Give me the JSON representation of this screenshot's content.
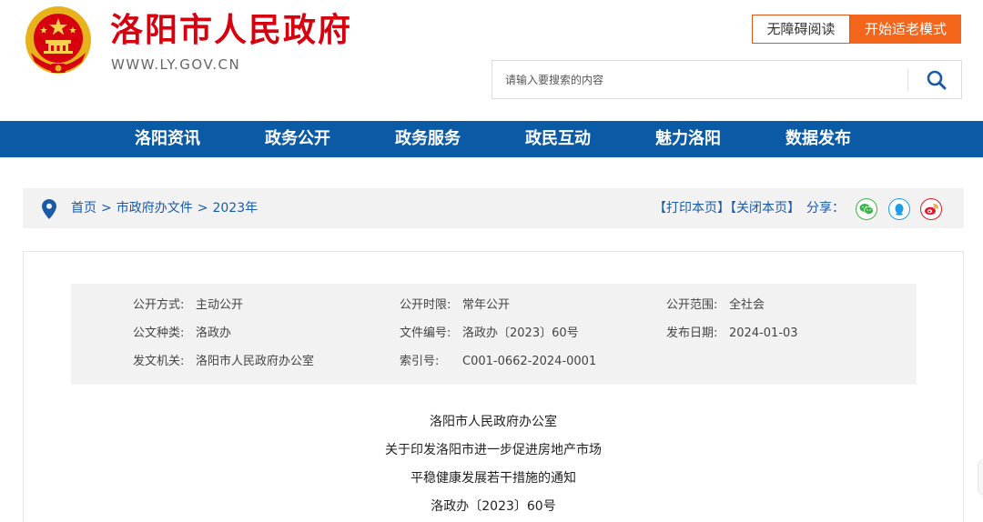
{
  "header": {
    "site_title": "洛阳市人民政府",
    "site_domain": "WWW.LY.GOV.CN",
    "accessible_label": "无障碍阅读",
    "elder_mode_label": "开始适老模式"
  },
  "search": {
    "placeholder": "请输入要搜索的内容"
  },
  "nav": {
    "items": [
      "洛阳资讯",
      "政务公开",
      "政务服务",
      "政民互动",
      "魅力洛阳",
      "数据发布"
    ]
  },
  "breadcrumb": {
    "items": [
      "首页",
      "市政府办文件",
      "2023年"
    ],
    "separator": ">"
  },
  "tools": {
    "print": "【打印本页】",
    "close": "【关闭本页】",
    "share": "分享："
  },
  "meta": {
    "rows": [
      [
        {
          "k": "公开方式:",
          "v": "主动公开"
        },
        {
          "k": "公开时限:",
          "v": "常年公开"
        },
        {
          "k": "公开范围:",
          "v": "全社会"
        }
      ],
      [
        {
          "k": "公文种类:",
          "v": "洛政办"
        },
        {
          "k": "文件编号:",
          "v": "洛政办〔2023〕60号"
        },
        {
          "k": "发布日期:",
          "v": "2024-01-03"
        }
      ],
      [
        {
          "k": "发文机关:",
          "v": "洛阳市人民政府办公室"
        },
        {
          "k": "索引号:",
          "v": "C001-0662-2024-0001"
        }
      ]
    ]
  },
  "document": {
    "lines": [
      "洛阳市人民政府办公室",
      "关于印发洛阳市进一步促进房地产市场",
      "平稳健康发展若干措施的通知",
      "洛政办〔2023〕60号"
    ]
  },
  "colors": {
    "brand_red": "#d7000f",
    "nav_blue": "#0b5aa6",
    "accent_orange": "#f2651b",
    "link_blue": "#1b5aa8",
    "wechat_green": "#3bb34a",
    "qq_blue": "#1e9ee6",
    "weibo_red": "#e6162d"
  }
}
